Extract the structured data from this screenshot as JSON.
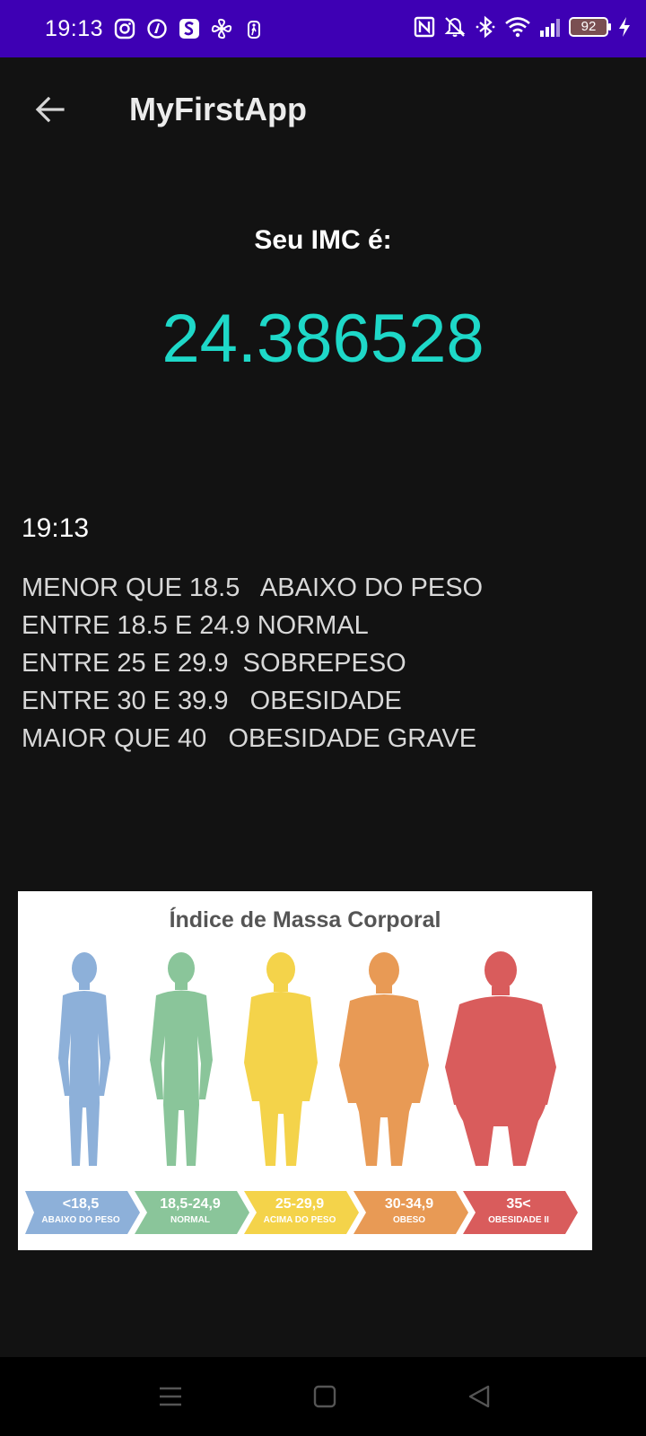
{
  "status_bar": {
    "time": "19:13",
    "battery_level": "92",
    "left_icons": [
      "instagram-icon",
      "app-icon",
      "s-app-icon",
      "fan-icon",
      "runner-icon"
    ],
    "right_icons": [
      "nfc-icon",
      "mute-icon",
      "bluetooth-icon",
      "wifi-icon",
      "signal-icon",
      "battery-icon",
      "charging-icon"
    ]
  },
  "app_bar": {
    "title": "MyFirstApp",
    "back_icon": "arrow-left-icon"
  },
  "result": {
    "label": "Seu IMC é:",
    "value": "24.386528",
    "value_color": "#1ed8c8"
  },
  "clock_text": "19:13",
  "ranges": [
    "MENOR QUE 18.5   ABAIXO DO PESO",
    "ENTRE 18.5 E 24.9 NORMAL",
    "ENTRE 25 E 29.9  SOBREPESO",
    "ENTRE 30 E 39.9   OBESIDADE",
    "MAIOR QUE 40   OBESIDADE GRAVE"
  ],
  "infographic": {
    "title": "Índice de Massa Corporal",
    "categories": [
      {
        "range": "<18,5",
        "label": "ABAIXO DO PESO",
        "color": "#8db0d9"
      },
      {
        "range": "18,5-24,9",
        "label": "NORMAL",
        "color": "#8ac59a"
      },
      {
        "range": "25-29,9",
        "label": "ACIMA DO PESO",
        "color": "#f4d34a"
      },
      {
        "range": "30-34,9",
        "label": "OBESO",
        "color": "#e89a55"
      },
      {
        "range": "35<",
        "label": "OBESIDADE II",
        "color": "#d95c5c"
      }
    ]
  },
  "nav_bar": {
    "icons": [
      "menu-icon",
      "home-icon",
      "back-triangle-icon"
    ]
  },
  "colors": {
    "status_bar": "#3e00b4",
    "background": "#121212"
  }
}
